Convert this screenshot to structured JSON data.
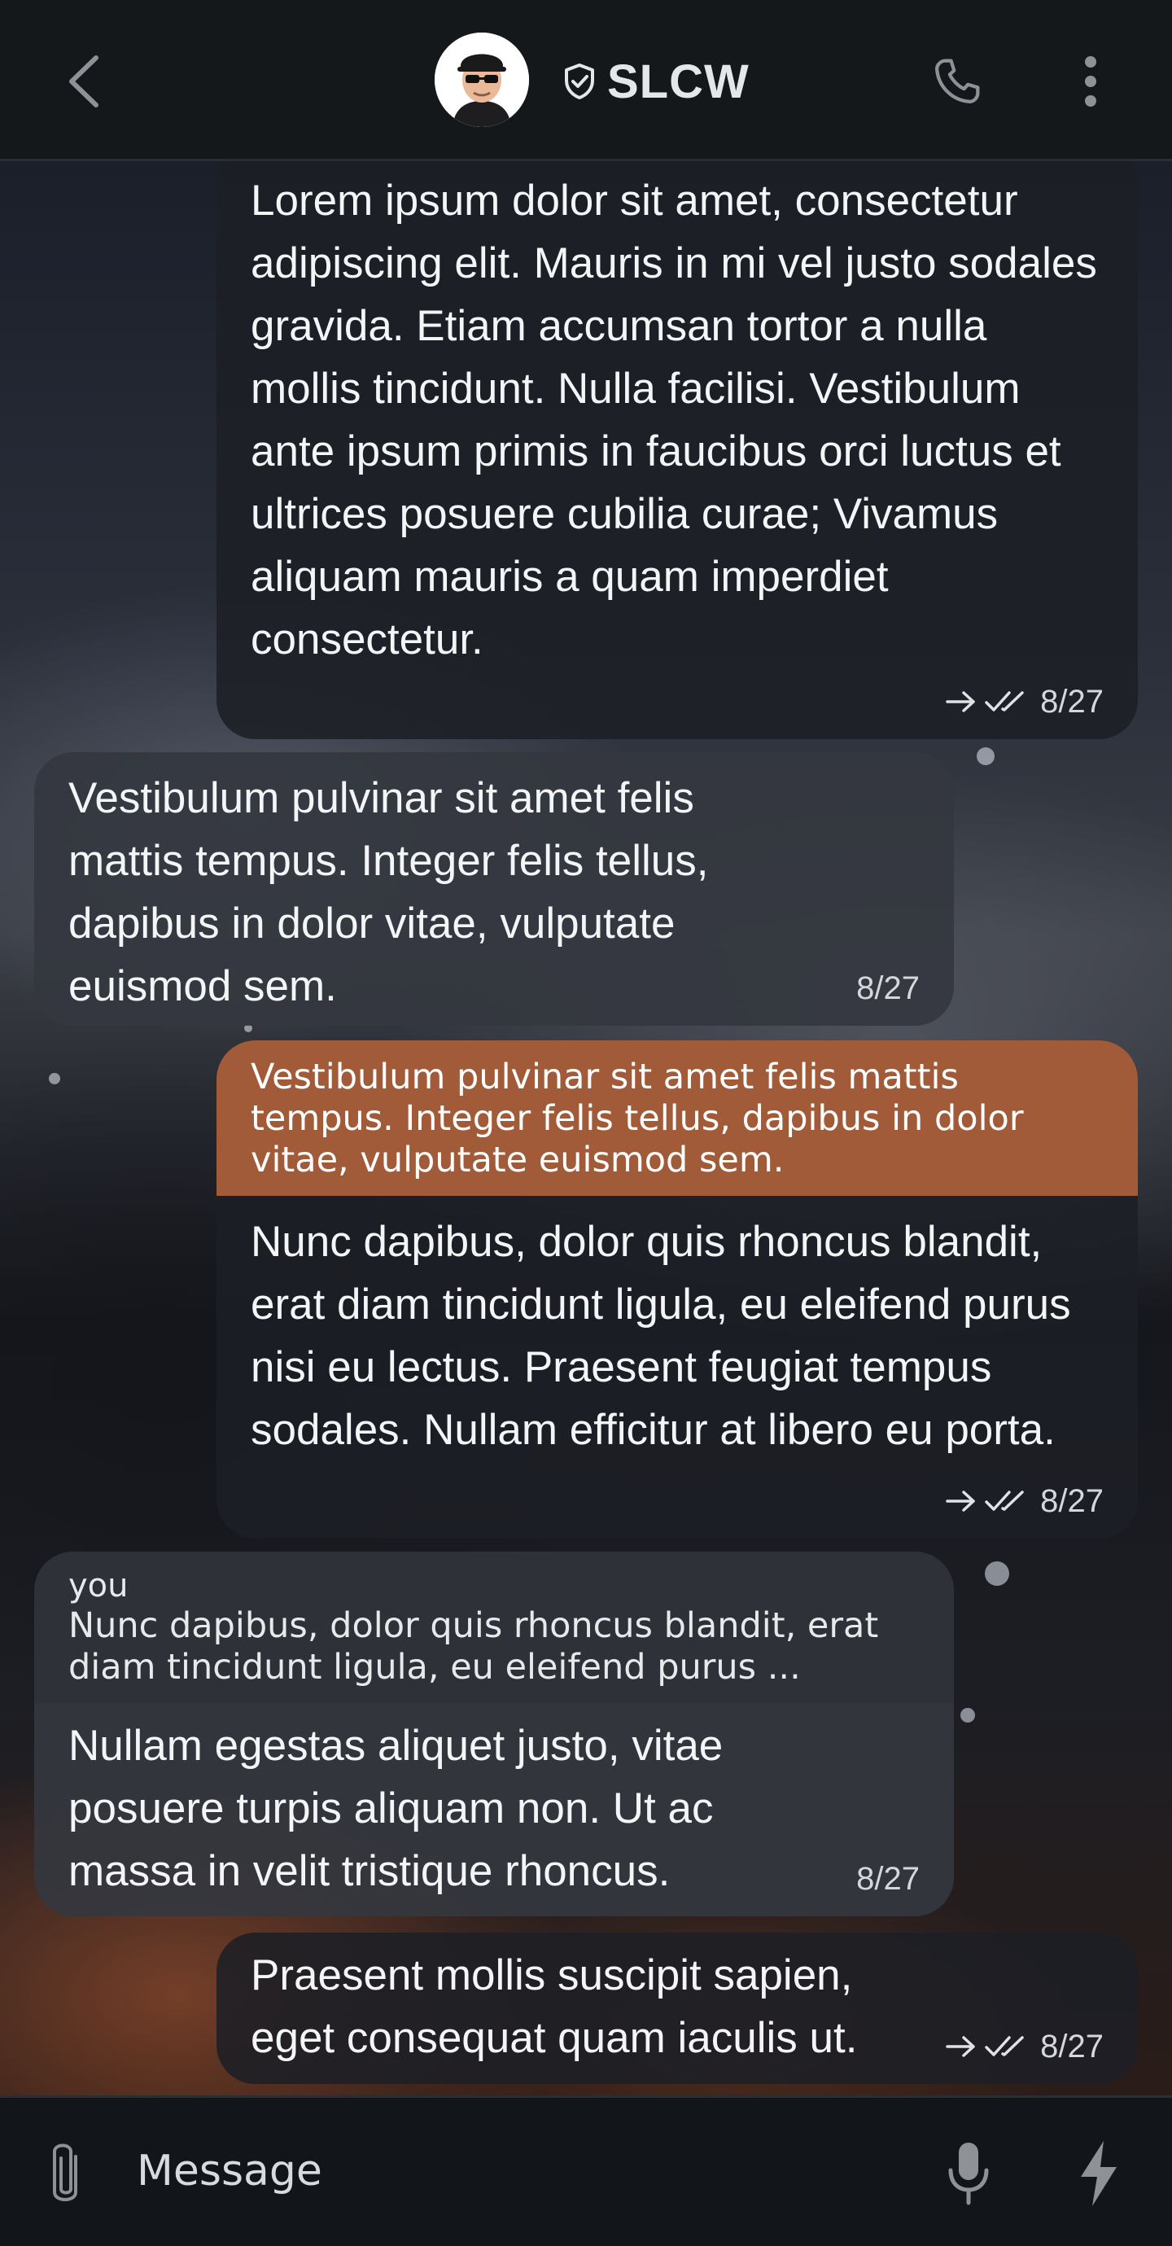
{
  "header": {
    "title": "SLCW",
    "icons": {
      "back": "back-arrow-icon",
      "verified": "shield-check-icon",
      "call": "phone-icon",
      "menu": "more-vertical-icon"
    }
  },
  "messages": [
    {
      "direction": "out",
      "text": "Lorem ipsum dolor sit amet, consectetur adipiscing elit. Mauris in mi vel justo sodales gravida. Etiam accumsan tortor a nulla mollis tincidunt. Nulla facilisi. Vestibulum ante ipsum primis in faucibus orci luctus et ultrices posuere cubilia curae; Vivamus aliquam mauris a quam imperdiet consectetur.",
      "time": "8/27",
      "status": "read"
    },
    {
      "direction": "in",
      "text": "Vestibulum pulvinar sit amet felis mattis tempus. Integer felis tellus, dapibus in dolor vitae, vulputate euismod sem.",
      "time": "8/27"
    },
    {
      "direction": "out",
      "quote": "Vestibulum pulvinar sit amet felis mattis tempus. Integer felis tellus, dapibus in dolor vitae, vulputate euismod sem.",
      "text": "Nunc dapibus, dolor quis rhoncus blandit, erat diam tincidunt ligula, eu eleifend purus nisi eu lectus. Praesent feugiat tempus sodales. Nullam efficitur at libero eu porta.",
      "time": "8/27",
      "status": "read"
    },
    {
      "direction": "in",
      "quote_author": "you",
      "quote": "Nunc dapibus, dolor quis rhoncus blandit, erat diam tincidunt ligula, eu eleifend purus ...",
      "text": "Nullam egestas aliquet justo, vitae posuere turpis aliquam non. Ut ac massa in velit tristique rhoncus.",
      "time": "8/27"
    },
    {
      "direction": "out",
      "text": "Praesent mollis suscipit sapien, eget consequat quam iaculis ut.",
      "time": "8/27",
      "status": "read"
    }
  ],
  "composer": {
    "placeholder": "Message",
    "icons": {
      "attach": "paperclip-icon",
      "mic": "microphone-icon",
      "quick": "lightning-bolt-icon"
    }
  },
  "colors": {
    "header_bg": "#15181b",
    "quote_accent": "#a15b38",
    "bubble_out": "#1c1f25",
    "bubble_in": "#34373f",
    "icon_gray": "#8e9196"
  }
}
